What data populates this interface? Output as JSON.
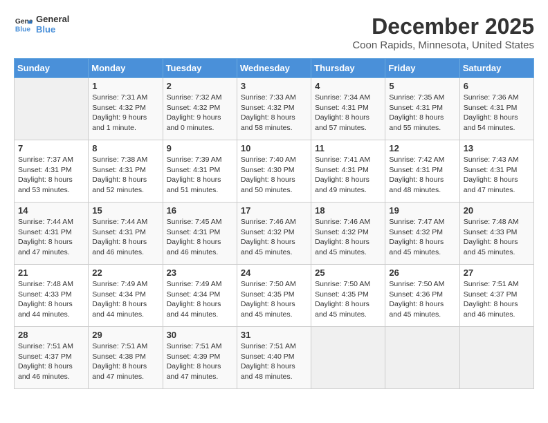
{
  "logo": {
    "line1": "General",
    "line2": "Blue"
  },
  "title": "December 2025",
  "subtitle": "Coon Rapids, Minnesota, United States",
  "headers": [
    "Sunday",
    "Monday",
    "Tuesday",
    "Wednesday",
    "Thursday",
    "Friday",
    "Saturday"
  ],
  "weeks": [
    [
      {
        "day": "",
        "info": ""
      },
      {
        "day": "1",
        "info": "Sunrise: 7:31 AM\nSunset: 4:32 PM\nDaylight: 9 hours\nand 1 minute."
      },
      {
        "day": "2",
        "info": "Sunrise: 7:32 AM\nSunset: 4:32 PM\nDaylight: 9 hours\nand 0 minutes."
      },
      {
        "day": "3",
        "info": "Sunrise: 7:33 AM\nSunset: 4:32 PM\nDaylight: 8 hours\nand 58 minutes."
      },
      {
        "day": "4",
        "info": "Sunrise: 7:34 AM\nSunset: 4:31 PM\nDaylight: 8 hours\nand 57 minutes."
      },
      {
        "day": "5",
        "info": "Sunrise: 7:35 AM\nSunset: 4:31 PM\nDaylight: 8 hours\nand 55 minutes."
      },
      {
        "day": "6",
        "info": "Sunrise: 7:36 AM\nSunset: 4:31 PM\nDaylight: 8 hours\nand 54 minutes."
      }
    ],
    [
      {
        "day": "7",
        "info": "Sunrise: 7:37 AM\nSunset: 4:31 PM\nDaylight: 8 hours\nand 53 minutes."
      },
      {
        "day": "8",
        "info": "Sunrise: 7:38 AM\nSunset: 4:31 PM\nDaylight: 8 hours\nand 52 minutes."
      },
      {
        "day": "9",
        "info": "Sunrise: 7:39 AM\nSunset: 4:31 PM\nDaylight: 8 hours\nand 51 minutes."
      },
      {
        "day": "10",
        "info": "Sunrise: 7:40 AM\nSunset: 4:30 PM\nDaylight: 8 hours\nand 50 minutes."
      },
      {
        "day": "11",
        "info": "Sunrise: 7:41 AM\nSunset: 4:31 PM\nDaylight: 8 hours\nand 49 minutes."
      },
      {
        "day": "12",
        "info": "Sunrise: 7:42 AM\nSunset: 4:31 PM\nDaylight: 8 hours\nand 48 minutes."
      },
      {
        "day": "13",
        "info": "Sunrise: 7:43 AM\nSunset: 4:31 PM\nDaylight: 8 hours\nand 47 minutes."
      }
    ],
    [
      {
        "day": "14",
        "info": "Sunrise: 7:44 AM\nSunset: 4:31 PM\nDaylight: 8 hours\nand 47 minutes."
      },
      {
        "day": "15",
        "info": "Sunrise: 7:44 AM\nSunset: 4:31 PM\nDaylight: 8 hours\nand 46 minutes."
      },
      {
        "day": "16",
        "info": "Sunrise: 7:45 AM\nSunset: 4:31 PM\nDaylight: 8 hours\nand 46 minutes."
      },
      {
        "day": "17",
        "info": "Sunrise: 7:46 AM\nSunset: 4:32 PM\nDaylight: 8 hours\nand 45 minutes."
      },
      {
        "day": "18",
        "info": "Sunrise: 7:46 AM\nSunset: 4:32 PM\nDaylight: 8 hours\nand 45 minutes."
      },
      {
        "day": "19",
        "info": "Sunrise: 7:47 AM\nSunset: 4:32 PM\nDaylight: 8 hours\nand 45 minutes."
      },
      {
        "day": "20",
        "info": "Sunrise: 7:48 AM\nSunset: 4:33 PM\nDaylight: 8 hours\nand 45 minutes."
      }
    ],
    [
      {
        "day": "21",
        "info": "Sunrise: 7:48 AM\nSunset: 4:33 PM\nDaylight: 8 hours\nand 44 minutes."
      },
      {
        "day": "22",
        "info": "Sunrise: 7:49 AM\nSunset: 4:34 PM\nDaylight: 8 hours\nand 44 minutes."
      },
      {
        "day": "23",
        "info": "Sunrise: 7:49 AM\nSunset: 4:34 PM\nDaylight: 8 hours\nand 44 minutes."
      },
      {
        "day": "24",
        "info": "Sunrise: 7:50 AM\nSunset: 4:35 PM\nDaylight: 8 hours\nand 45 minutes."
      },
      {
        "day": "25",
        "info": "Sunrise: 7:50 AM\nSunset: 4:35 PM\nDaylight: 8 hours\nand 45 minutes."
      },
      {
        "day": "26",
        "info": "Sunrise: 7:50 AM\nSunset: 4:36 PM\nDaylight: 8 hours\nand 45 minutes."
      },
      {
        "day": "27",
        "info": "Sunrise: 7:51 AM\nSunset: 4:37 PM\nDaylight: 8 hours\nand 46 minutes."
      }
    ],
    [
      {
        "day": "28",
        "info": "Sunrise: 7:51 AM\nSunset: 4:37 PM\nDaylight: 8 hours\nand 46 minutes."
      },
      {
        "day": "29",
        "info": "Sunrise: 7:51 AM\nSunset: 4:38 PM\nDaylight: 8 hours\nand 47 minutes."
      },
      {
        "day": "30",
        "info": "Sunrise: 7:51 AM\nSunset: 4:39 PM\nDaylight: 8 hours\nand 47 minutes."
      },
      {
        "day": "31",
        "info": "Sunrise: 7:51 AM\nSunset: 4:40 PM\nDaylight: 8 hours\nand 48 minutes."
      },
      {
        "day": "",
        "info": ""
      },
      {
        "day": "",
        "info": ""
      },
      {
        "day": "",
        "info": ""
      }
    ]
  ]
}
